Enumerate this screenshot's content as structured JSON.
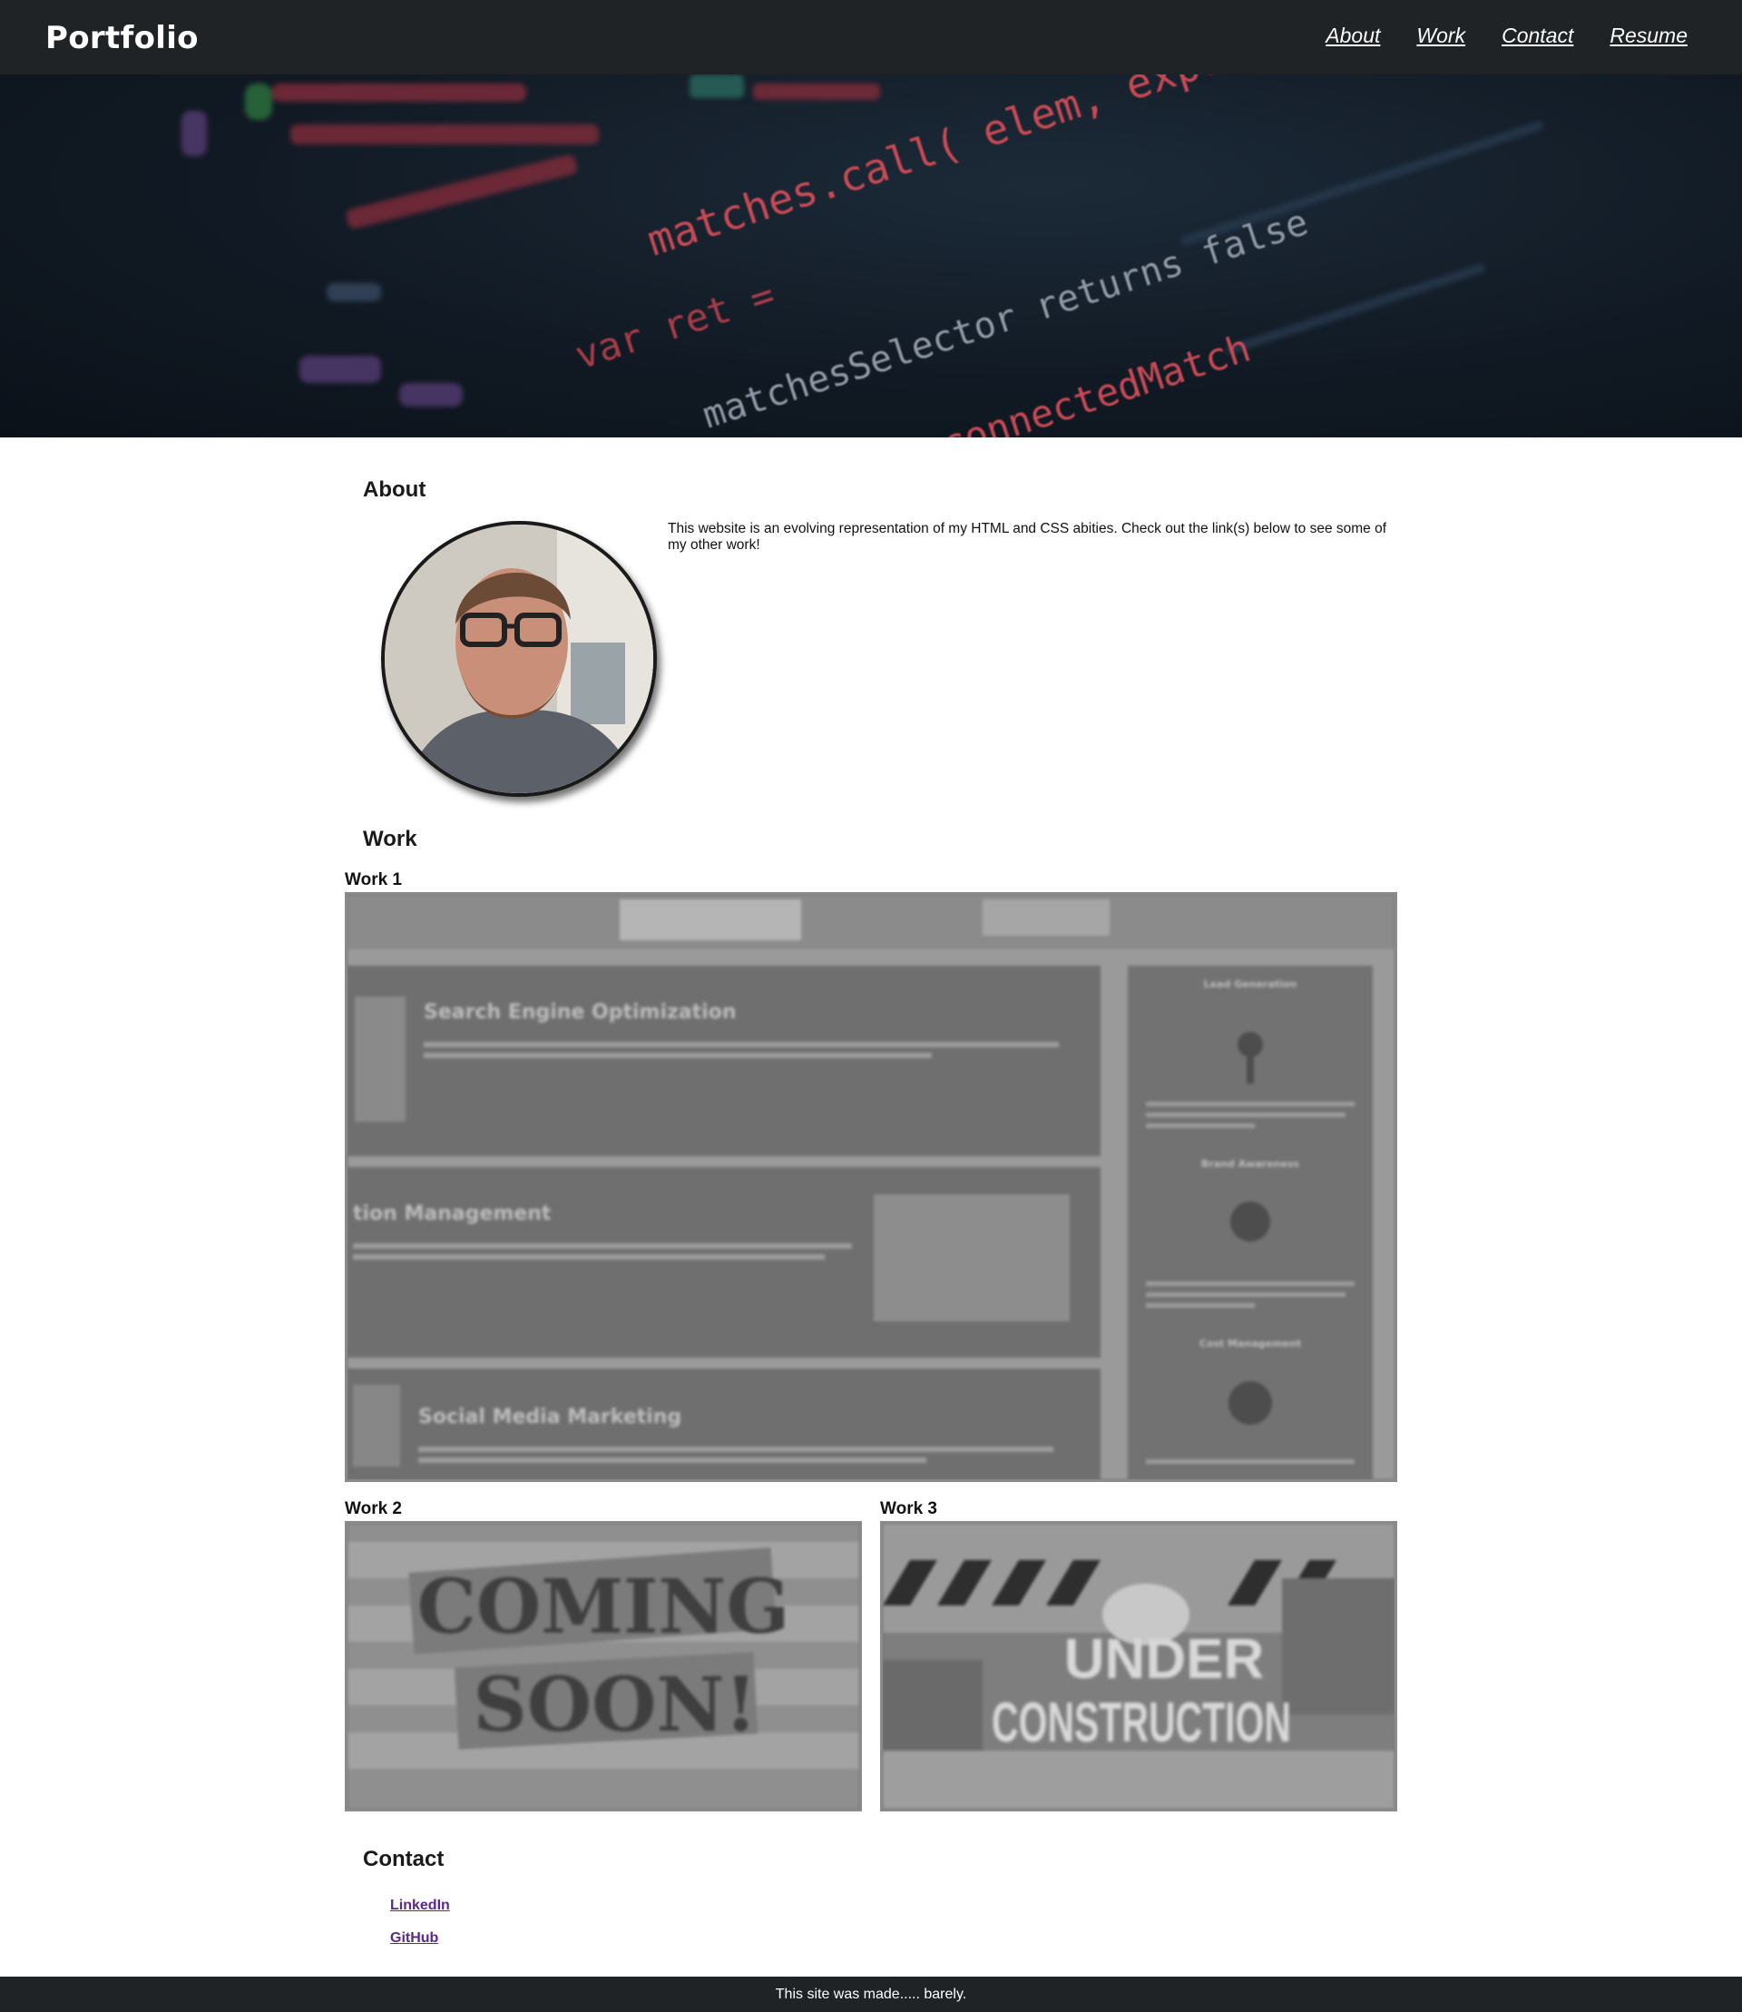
{
  "header": {
    "brand": "Portfolio",
    "nav": [
      {
        "label": "About"
      },
      {
        "label": "Work"
      },
      {
        "label": "Contact"
      },
      {
        "label": "Resume"
      }
    ]
  },
  "hero": {
    "code_lines": [
      "matches.call( elem, expr );",
      "matchesSelector returns false",
      "rt.disconnectedMatch",
      "var ret ="
    ]
  },
  "about": {
    "title": "About",
    "text": "This website is an evolving representation of my HTML and CSS abities. Check out the link(s) below to see some of my other work!"
  },
  "work": {
    "title": "Work",
    "items": [
      {
        "label": "Work 1",
        "headings": [
          "Search Engine Optimization",
          "tion Management",
          "Social Media Marketing"
        ],
        "sidebar": [
          "Lead Generation",
          "Brand Awareness",
          "Cost Management"
        ]
      },
      {
        "label": "Work 2",
        "sign_lines": [
          "COMING",
          "SOON!"
        ]
      },
      {
        "label": "Work 3",
        "sign_lines": [
          "UNDER",
          "CONSTRUCTION"
        ]
      }
    ]
  },
  "contact": {
    "title": "Contact",
    "links": [
      {
        "label": "LinkedIn"
      },
      {
        "label": "GitHub"
      }
    ]
  },
  "footer": {
    "text": "This site was made..... barely."
  }
}
